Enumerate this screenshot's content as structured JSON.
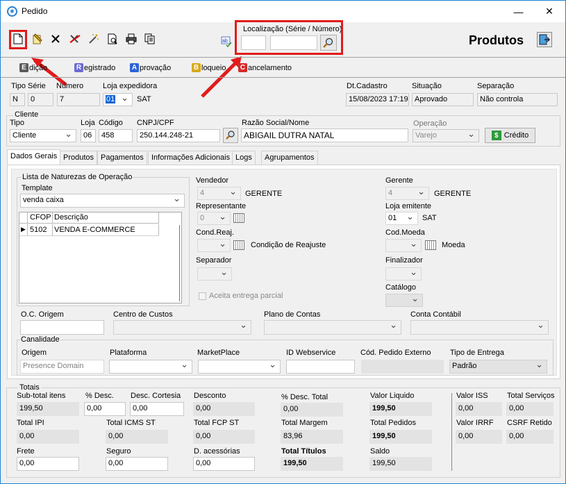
{
  "window": {
    "title": "Pedido"
  },
  "toolbar": {
    "localizacao_label": "Localização (Série / Número)",
    "serie_value": "",
    "numero_value": "",
    "produtos_label": "Produtos"
  },
  "modes": [
    {
      "letter": "E",
      "rest": "dição",
      "color": "#5a5a5a"
    },
    {
      "letter": "R",
      "rest": "egistrado",
      "color": "#6a6ad8"
    },
    {
      "letter": "A",
      "rest": "provação",
      "color": "#2b63d9"
    },
    {
      "letter": "B",
      "rest": "loqueio",
      "color": "#d8a81a"
    },
    {
      "letter": "C",
      "rest": "ancelamento",
      "color": "#d42a2a"
    }
  ],
  "header": {
    "tipo_serie_label": "Tipo Série",
    "tipo": "N",
    "serie": "0",
    "numero_label": "Número",
    "numero": "7",
    "loja_exp_label": "Loja expedidora",
    "loja_exp": "01",
    "loja_exp_name": "SAT",
    "dt_cadastro_label": "Dt.Cadastro",
    "dt_cadastro": "15/08/2023 17:19",
    "situacao_label": "Situação",
    "situacao": "Aprovado",
    "separacao_label": "Separação",
    "separacao": "Não controla"
  },
  "cliente": {
    "group_label": "Cliente",
    "tipo_label": "Tipo",
    "tipo": "Cliente",
    "loja_label": "Loja",
    "loja": "06",
    "codigo_label": "Código",
    "codigo": "458",
    "cnpj_label": "CNPJ/CPF",
    "cnpj": "250.144.248-21",
    "razao_label": "Razão Social/Nome",
    "razao": "ABIGAIL DUTRA NATAL",
    "operacao_label": "Operação",
    "operacao": "Varejo",
    "credito_label": "Crédito"
  },
  "tabs": [
    "Dados Gerais",
    "Produtos",
    "Pagamentos",
    "Informações Adicionais",
    "Logs",
    "Agrupamentos"
  ],
  "dados": {
    "naturezas_label": "Lista de Naturezas de Operação",
    "template_label": "Template",
    "template": "venda caixa",
    "grid_headers": [
      "CFOP",
      "Descrição"
    ],
    "grid_rows": [
      {
        "cfop": "5102",
        "descricao": "VENDA E-COMMERCE"
      }
    ],
    "vendedor_label": "Vendedor",
    "vendedor_cod": "4",
    "vendedor_nome": "GERENTE",
    "representante_label": "Representante",
    "representante_cod": "0",
    "condreaj_label": "Cond.Reaj.",
    "condreaj_desc": "Condição de Reajuste",
    "separador_label": "Separador",
    "aceita_label": "Aceita entrega parcial",
    "gerente_label": "Gerente",
    "gerente_cod": "4",
    "gerente_nome": "GERENTE",
    "loja_emit_label": "Loja emitente",
    "loja_emit": "01",
    "loja_emit_name": "SAT",
    "codmoeda_label": "Cod.Moeda",
    "moeda_desc": "Moeda",
    "finalizador_label": "Finalizador",
    "catalogo_label": "Catálogo",
    "oc_label": "O.C. Origem",
    "centro_label": "Centro de Custos",
    "plano_label": "Plano de Contas",
    "conta_label": "Conta Contábil",
    "canalidade_label": "Canalidade",
    "origem_label": "Origem",
    "origem": "Presence Domain",
    "plataforma_label": "Plataforma",
    "marketplace_label": "MarketPlace",
    "idweb_label": "ID Webservice",
    "codext_label": "Cód. Pedido Externo",
    "tipoentrega_label": "Tipo de Entrega",
    "tipoentrega": "Padrão"
  },
  "totais": {
    "label": "Totais",
    "subtotal_label": "Sub-total itens",
    "subtotal": "199,50",
    "pdesc_label": "% Desc.",
    "pdesc": "0,00",
    "desccort_label": "Desc. Cortesia",
    "desccort": "0,00",
    "desconto_label": "Desconto",
    "desconto": "0,00",
    "pdesctotal_label": "% Desc. Total",
    "pdesctotal": "0,00",
    "valorliq_label": "Valor Liquido",
    "valorliq": "199,50",
    "valoriss_label": "Valor ISS",
    "valoriss": "0,00",
    "totserv_label": "Total Serviços",
    "totserv": "0,00",
    "totipi_label": "Total IPI",
    "totipi": "0,00",
    "toticmsst_label": "Total ICMS ST",
    "toticmsst": "0,00",
    "totfcpst_label": "Total FCP ST",
    "totfcpst": "0,00",
    "totmargem_label": "Total Margem",
    "totmargem": "83,96",
    "totpedidos_label": "Total Pedidos",
    "totpedidos": "199,50",
    "valorirrf_label": "Valor IRRF",
    "valorirrf": "0,00",
    "csrf_label": "CSRF Retido",
    "csrf": "0,00",
    "frete_label": "Frete",
    "frete": "0,00",
    "seguro_label": "Seguro",
    "seguro": "0,00",
    "dacess_label": "D. acessórias",
    "dacess": "0,00",
    "tottitulos_label": "Total Títulos",
    "tottitulos": "199,50",
    "saldo_label": "Saldo",
    "saldo": "199,50"
  },
  "colors": {
    "highlight_red": "#e21b1b",
    "title_border": "#1883d7",
    "credit_green": "#2e9a3a"
  }
}
